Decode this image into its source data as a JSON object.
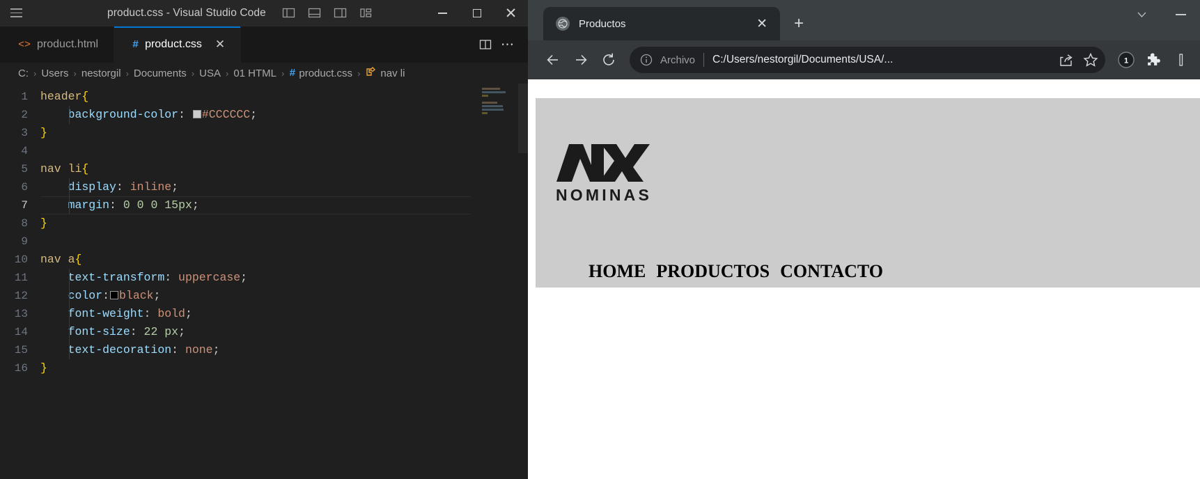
{
  "vscode": {
    "window_title": "product.css - Visual Studio Code",
    "menu_icon": "hamburger-menu-icon",
    "layout_icons": [
      "toggle-primary-sidebar-icon",
      "toggle-panel-icon",
      "toggle-secondary-sidebar-icon",
      "customize-layout-icon"
    ],
    "window_controls": {
      "minimize": "minimize-icon",
      "maximize": "maximize-icon",
      "close": "close-icon"
    },
    "tabs": [
      {
        "label": "product.html",
        "icon": "html-file-icon",
        "active": false,
        "closable": false
      },
      {
        "label": "product.css",
        "icon": "css-file-icon",
        "active": true,
        "closable": true,
        "close_label": "✕"
      }
    ],
    "tab_actions": {
      "split_editor": "split-editor-icon",
      "more": "⋯"
    },
    "breadcrumb": {
      "separator": "›",
      "items": [
        "C:",
        "Users",
        "nestorgil",
        "Documents",
        "USA",
        "01 HTML",
        "product.css",
        "nav li"
      ],
      "file_icon": "#",
      "symbol_icon": "css-selector-symbol-icon"
    },
    "editor": {
      "current_line": 7,
      "lines": [
        {
          "n": 1,
          "tokens": [
            {
              "t": "header",
              "c": "tok-sel"
            },
            {
              "t": "{",
              "c": "tok-brace"
            }
          ],
          "indent": false
        },
        {
          "n": 2,
          "tokens": [
            {
              "t": "    background-color",
              "c": "tok-prop"
            },
            {
              "t": ": ",
              "c": "tok-punc"
            },
            {
              "t": "■",
              "c": "colorbox"
            },
            {
              "t": "#CCCCCC",
              "c": "tok-val"
            },
            {
              "t": ";",
              "c": "tok-punc"
            }
          ],
          "indent": true
        },
        {
          "n": 3,
          "tokens": [
            {
              "t": "}",
              "c": "tok-brace"
            }
          ],
          "indent": false
        },
        {
          "n": 4,
          "tokens": [],
          "indent": false
        },
        {
          "n": 5,
          "tokens": [
            {
              "t": "nav ",
              "c": "tok-sel"
            },
            {
              "t": "li",
              "c": "tok-sel"
            },
            {
              "t": "{",
              "c": "tok-brace"
            }
          ],
          "indent": false
        },
        {
          "n": 6,
          "tokens": [
            {
              "t": "    display",
              "c": "tok-prop"
            },
            {
              "t": ": ",
              "c": "tok-punc"
            },
            {
              "t": "inline",
              "c": "tok-val"
            },
            {
              "t": ";",
              "c": "tok-punc"
            }
          ],
          "indent": true
        },
        {
          "n": 7,
          "tokens": [
            {
              "t": "    margin",
              "c": "tok-prop"
            },
            {
              "t": ": ",
              "c": "tok-punc"
            },
            {
              "t": "0 0 0 15",
              "c": "tok-num"
            },
            {
              "t": "px",
              "c": "tok-num"
            },
            {
              "t": ";",
              "c": "tok-punc"
            }
          ],
          "indent": true
        },
        {
          "n": 8,
          "tokens": [
            {
              "t": "}",
              "c": "tok-brace"
            }
          ],
          "indent": false
        },
        {
          "n": 9,
          "tokens": [],
          "indent": false
        },
        {
          "n": 10,
          "tokens": [
            {
              "t": "nav ",
              "c": "tok-sel"
            },
            {
              "t": "a",
              "c": "tok-sel"
            },
            {
              "t": "{",
              "c": "tok-brace"
            }
          ],
          "indent": false
        },
        {
          "n": 11,
          "tokens": [
            {
              "t": "    text-transform",
              "c": "tok-prop"
            },
            {
              "t": ": ",
              "c": "tok-punc"
            },
            {
              "t": "uppercase",
              "c": "tok-val"
            },
            {
              "t": ";",
              "c": "tok-punc"
            }
          ],
          "indent": true
        },
        {
          "n": 12,
          "tokens": [
            {
              "t": "    color",
              "c": "tok-prop"
            },
            {
              "t": ":",
              "c": "tok-punc"
            },
            {
              "t": "■",
              "c": "colorbox-black"
            },
            {
              "t": "black",
              "c": "tok-val"
            },
            {
              "t": ";",
              "c": "tok-punc"
            }
          ],
          "indent": true
        },
        {
          "n": 13,
          "tokens": [
            {
              "t": "    font-weight",
              "c": "tok-prop"
            },
            {
              "t": ": ",
              "c": "tok-punc"
            },
            {
              "t": "bold",
              "c": "tok-val"
            },
            {
              "t": ";",
              "c": "tok-punc"
            }
          ],
          "indent": true
        },
        {
          "n": 14,
          "tokens": [
            {
              "t": "    font-size",
              "c": "tok-prop"
            },
            {
              "t": ": ",
              "c": "tok-punc"
            },
            {
              "t": "22",
              "c": "tok-num"
            },
            {
              "t": " px",
              "c": "tok-num"
            },
            {
              "t": ";",
              "c": "tok-punc"
            }
          ],
          "indent": true
        },
        {
          "n": 15,
          "tokens": [
            {
              "t": "    text-decoration",
              "c": "tok-prop"
            },
            {
              "t": ": ",
              "c": "tok-punc"
            },
            {
              "t": "none",
              "c": "tok-val"
            },
            {
              "t": ";",
              "c": "tok-punc"
            }
          ],
          "indent": true
        },
        {
          "n": 16,
          "tokens": [
            {
              "t": "}",
              "c": "tok-brace"
            }
          ],
          "indent": false
        }
      ]
    },
    "theme": {
      "titlebar_bg": "#272727",
      "tabbar_bg": "#181818",
      "editor_bg": "#1f1f1f",
      "active_tab_border": "#0078d4",
      "selector_color": "#d7ba7d",
      "property_color": "#9cdcfe",
      "value_color": "#ce9178",
      "number_color": "#b5cea8",
      "brace_color": "#ffd700"
    }
  },
  "browser": {
    "tab": {
      "title": "Productos",
      "favicon": "globe-icon",
      "close": "✕"
    },
    "new_tab_label": "+",
    "window_controls": {
      "collapse": "chevron-down-icon",
      "minimize": "minimize-icon"
    },
    "toolbar": {
      "back": "back-arrow-icon",
      "forward": "forward-arrow-icon",
      "reload": "reload-icon",
      "info_icon": "info-circle-icon",
      "scheme_label": "Archivo",
      "url": "C:/Users/nestorgil/Documents/USA/...",
      "share": "share-icon",
      "bookmark": "star-icon",
      "badge_count": "1",
      "extensions": "puzzle-piece-icon"
    },
    "page": {
      "header_bg": "#cccccc",
      "logo": {
        "mark": "NX",
        "word": "NOMINAS"
      },
      "nav": [
        {
          "label": "HOME",
          "href": "#"
        },
        {
          "label": "PRODUCTOS",
          "href": "#"
        },
        {
          "label": "CONTACTO",
          "href": "#"
        }
      ]
    }
  }
}
